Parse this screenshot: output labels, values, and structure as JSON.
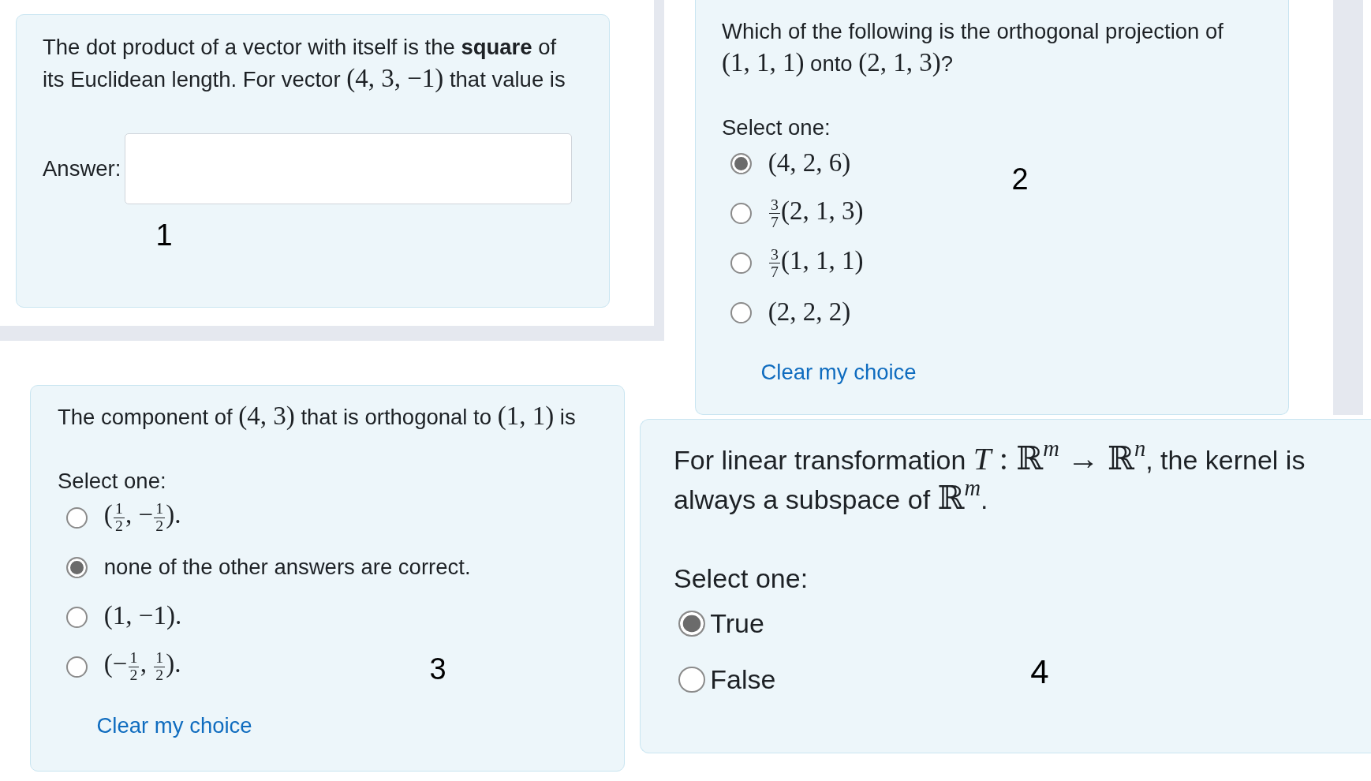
{
  "panels": [
    {
      "kind": "short_answer",
      "label": "1",
      "question": [
        {
          "kind": "text",
          "text": "The dot product of a vector with itself is the **square** of its Euclidean length. For vector "
        },
        {
          "kind": "math",
          "text": "(4, 3, −1)"
        },
        {
          "kind": "text",
          "text": " that value is"
        }
      ],
      "answer_label": "Answer:"
    },
    {
      "kind": "multichoice",
      "label": "2",
      "question": [
        {
          "kind": "text",
          "text": "Which of the following is the orthogonal projection of "
        },
        {
          "kind": "math",
          "text": "(1, 1, 1)"
        },
        {
          "kind": "text",
          "text": " onto "
        },
        {
          "kind": "math",
          "text": "(2, 1, 3)"
        },
        {
          "kind": "text",
          "text": "?"
        }
      ],
      "prompt": "Select one:",
      "options": [
        {
          "selected": true,
          "parts": [
            {
              "kind": "math",
              "text": "(4, 2, 6)"
            }
          ]
        },
        {
          "selected": false,
          "parts": [
            {
              "kind": "frac",
              "num": "3",
              "den": "7"
            },
            {
              "kind": "math",
              "text": "(2, 1, 3)"
            }
          ]
        },
        {
          "selected": false,
          "parts": [
            {
              "kind": "frac",
              "num": "3",
              "den": "7"
            },
            {
              "kind": "math",
              "text": "(1, 1, 1)"
            }
          ]
        },
        {
          "selected": false,
          "parts": [
            {
              "kind": "math",
              "text": "(2, 2, 2)"
            }
          ]
        }
      ],
      "clear_link": "Clear my choice"
    },
    {
      "kind": "multichoice",
      "label": "3",
      "question": [
        {
          "kind": "text",
          "text": "The component of "
        },
        {
          "kind": "math",
          "text": "(4, 3)"
        },
        {
          "kind": "text",
          "text": " that is orthogonal to "
        },
        {
          "kind": "math",
          "text": "(1, 1)"
        },
        {
          "kind": "text",
          "text": " is"
        }
      ],
      "prompt": "Select one:",
      "options": [
        {
          "selected": false,
          "parts": [
            {
              "kind": "math",
              "text": "("
            },
            {
              "kind": "frac",
              "num": "1",
              "den": "2"
            },
            {
              "kind": "math",
              "text": ", −"
            },
            {
              "kind": "frac",
              "num": "1",
              "den": "2"
            },
            {
              "kind": "math",
              "text": ")."
            }
          ]
        },
        {
          "selected": true,
          "parts": [
            {
              "kind": "text",
              "text": "none of the other answers are correct."
            }
          ]
        },
        {
          "selected": false,
          "parts": [
            {
              "kind": "math",
              "text": "(1, −1)."
            }
          ]
        },
        {
          "selected": false,
          "parts": [
            {
              "kind": "math",
              "text": "(−"
            },
            {
              "kind": "frac",
              "num": "1",
              "den": "2"
            },
            {
              "kind": "math",
              "text": ", "
            },
            {
              "kind": "frac",
              "num": "1",
              "den": "2"
            },
            {
              "kind": "math",
              "text": ")."
            }
          ]
        }
      ],
      "clear_link": "Clear my choice"
    },
    {
      "kind": "truefalse",
      "label": "4",
      "question": [
        {
          "kind": "text",
          "text": "For linear transformation "
        },
        {
          "kind": "math",
          "text": "*T* : ℝ$^{m}$ → ℝ$^{n}$"
        },
        {
          "kind": "text",
          "text": ", the kernel is always a subspace of "
        },
        {
          "kind": "math",
          "text": "ℝ$^{m}$"
        },
        {
          "kind": "text",
          "text": "."
        }
      ],
      "prompt": "Select one:",
      "options": [
        {
          "selected": true,
          "parts": [
            {
              "kind": "text",
              "text": "True"
            }
          ]
        },
        {
          "selected": false,
          "parts": [
            {
              "kind": "text",
              "text": "False"
            }
          ]
        }
      ]
    }
  ]
}
